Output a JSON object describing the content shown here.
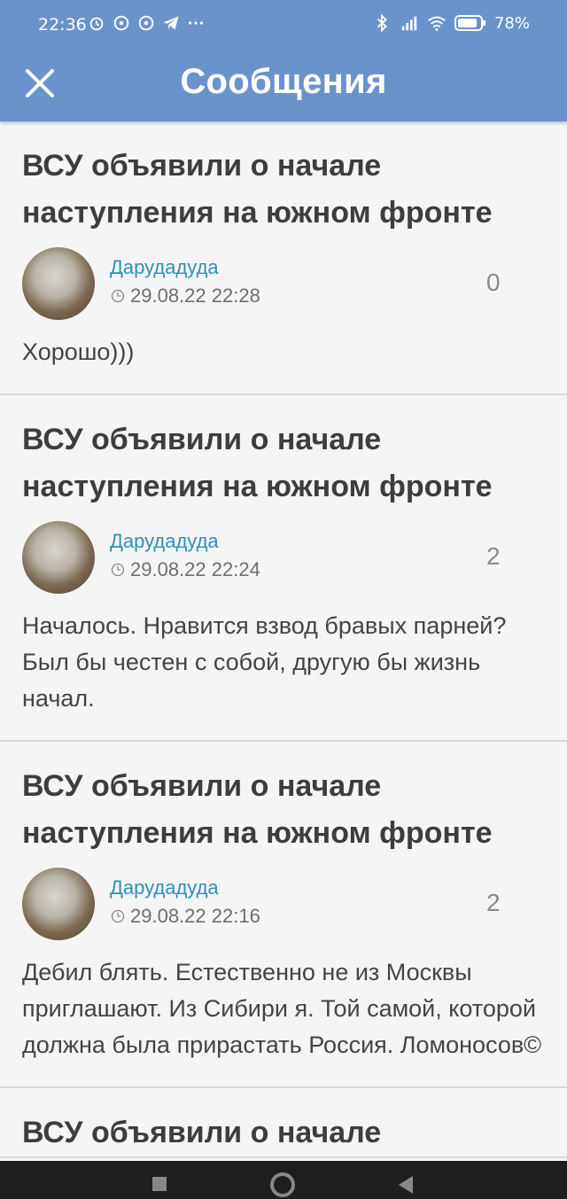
{
  "status_bar": {
    "time": "22:36",
    "battery": "78%"
  },
  "header": {
    "title": "Сообщения",
    "close_icon": "close-icon"
  },
  "messages": [
    {
      "title": "ВСУ объявили о начале наступления на южном фронте",
      "author": "Дарудадуда",
      "date": "29.08.22 22:28",
      "count": "0",
      "text": "Хорошо)))"
    },
    {
      "title": "ВСУ объявили о начале наступления на южном фронте",
      "author": "Дарудадуда",
      "date": "29.08.22 22:24",
      "count": "2",
      "text": "Началось. Нравится взвод бравых парней? Был бы честен с собой, другую бы жизнь начал."
    },
    {
      "title": "ВСУ объявили о начале наступления на южном фронте",
      "author": "Дарудадуда",
      "date": "29.08.22 22:16",
      "count": "2",
      "text": "Дебил блять. Естественно не из Москвы приглашают. Из Сибири я. Той самой, которой должна была прирастать Россия. Ломоносов©"
    },
    {
      "title": "ВСУ объявили о начале",
      "author": "",
      "date": "",
      "count": "",
      "text": ""
    }
  ],
  "colors": {
    "app_bar": "#6a93cb",
    "author": "#2f8fb8",
    "nav_bar": "#1e1e1e"
  }
}
